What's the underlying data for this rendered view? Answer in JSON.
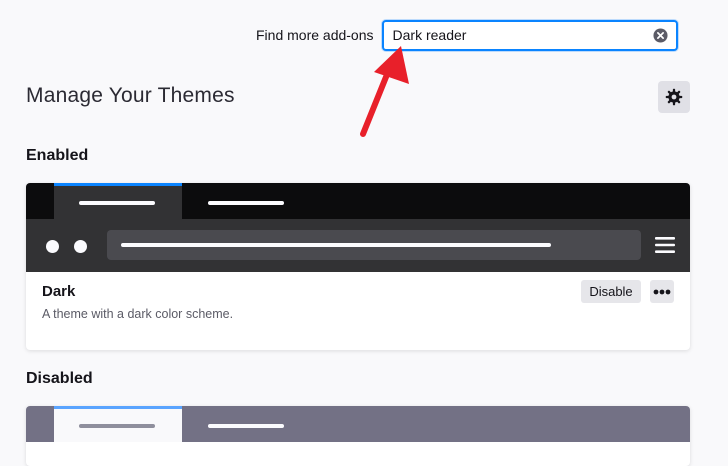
{
  "search": {
    "label": "Find more add-ons",
    "value": "Dark reader",
    "clear_icon": "clear-circle-icon"
  },
  "header": {
    "title": "Manage Your Themes",
    "settings_icon": "gear-icon"
  },
  "sections": {
    "enabled_heading": "Enabled",
    "disabled_heading": "Disabled"
  },
  "enabled_theme": {
    "name": "Dark",
    "description": "A theme with a dark color scheme.",
    "action_label": "Disable",
    "more_icon": "more-options-icon",
    "preview_colors": {
      "tab_strip": "#0c0c0d",
      "toolbar": "#323234",
      "accent": "#0a84ff"
    }
  },
  "disabled_theme": {
    "preview_colors": {
      "tab_strip": "#737185",
      "active_tab": "#f9f9fb",
      "accent": "#5aa4ff"
    }
  },
  "annotation": {
    "arrow_color": "#e8202a"
  },
  "colors": {
    "page_background": "#f9f9fb",
    "focus_ring": "#0a84ff",
    "button_background": "#e6e6ea"
  }
}
